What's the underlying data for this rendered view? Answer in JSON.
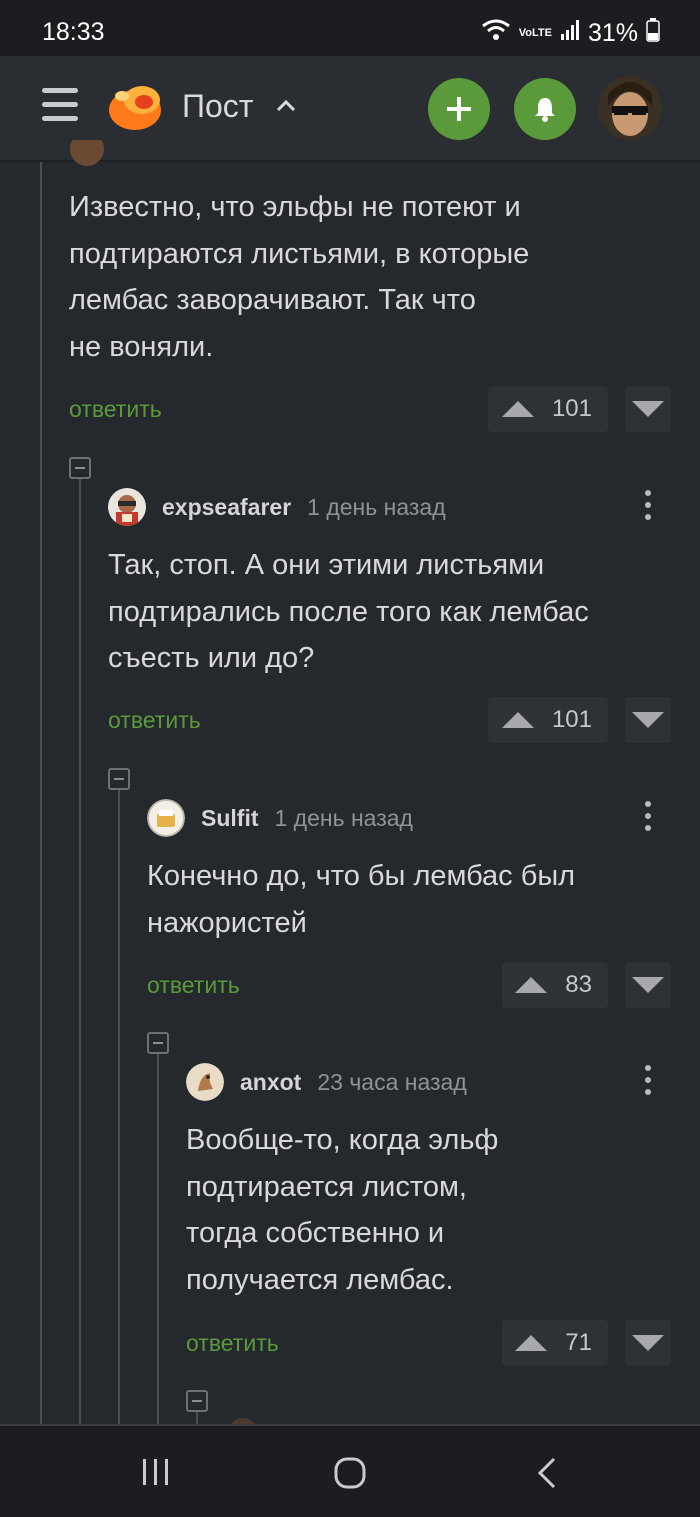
{
  "status_bar": {
    "time": "18:33",
    "network": "VoLTE",
    "battery": "31%"
  },
  "header": {
    "title": "Пост",
    "icons": [
      "menu-icon",
      "logo-icon",
      "chevron-up-icon",
      "plus-icon",
      "bell-icon"
    ]
  },
  "comments": [
    {
      "text_lines": [
        "Известно, что эльфы не потеют и",
        "подтираются листьями, в которые",
        "лембас заворачивают. Так что",
        "не воняли."
      ],
      "reply_label": "ответить",
      "votes": "101"
    },
    {
      "author": "expseafarer",
      "time": "1 день назад",
      "text_lines": [
        "Так, стоп. А они этими листьями",
        "подтирались после того как лембас",
        "съесть или до?"
      ],
      "reply_label": "ответить",
      "votes": "101"
    },
    {
      "author": "Sulfit",
      "time": "1 день назад",
      "text_lines": [
        "Конечно до, что бы лембас был",
        "нажористей"
      ],
      "reply_label": "ответить",
      "votes": "83"
    },
    {
      "author": "anxot",
      "time": "23 часа назад",
      "text_lines": [
        "Вообще-то, когда эльф",
        "подтирается листом,",
        "тогда собственно и",
        "получается лембас."
      ],
      "reply_label": "ответить",
      "votes": "71"
    }
  ],
  "colors": {
    "background": "#25282c",
    "accent": "#5a9a3a",
    "text": "#d8d9db",
    "muted": "#8f9296"
  }
}
